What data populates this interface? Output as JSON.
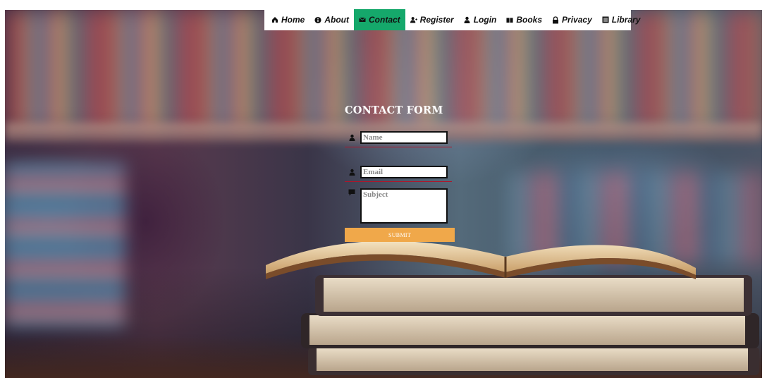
{
  "nav": {
    "items": [
      {
        "label": "Home",
        "icon": "home-icon",
        "active": false
      },
      {
        "label": "About",
        "icon": "info-icon",
        "active": false
      },
      {
        "label": "Contact",
        "icon": "envelope-icon",
        "active": true
      },
      {
        "label": "Register",
        "icon": "user-plus-icon",
        "active": false
      },
      {
        "label": "Login",
        "icon": "user-icon",
        "active": false
      },
      {
        "label": "Books",
        "icon": "book-icon",
        "active": false
      },
      {
        "label": "Privacy",
        "icon": "lock-icon",
        "active": false
      },
      {
        "label": "Library",
        "icon": "library-icon",
        "active": false
      }
    ],
    "active_color": "#15a86b"
  },
  "form": {
    "title": "CONTACT FORM",
    "name_placeholder": "Name",
    "email_placeholder": "Email",
    "subject_placeholder": "Subject",
    "submit_label": "SUBMIT",
    "submit_color": "#f0a84a",
    "underline_color": "#b0152a"
  }
}
